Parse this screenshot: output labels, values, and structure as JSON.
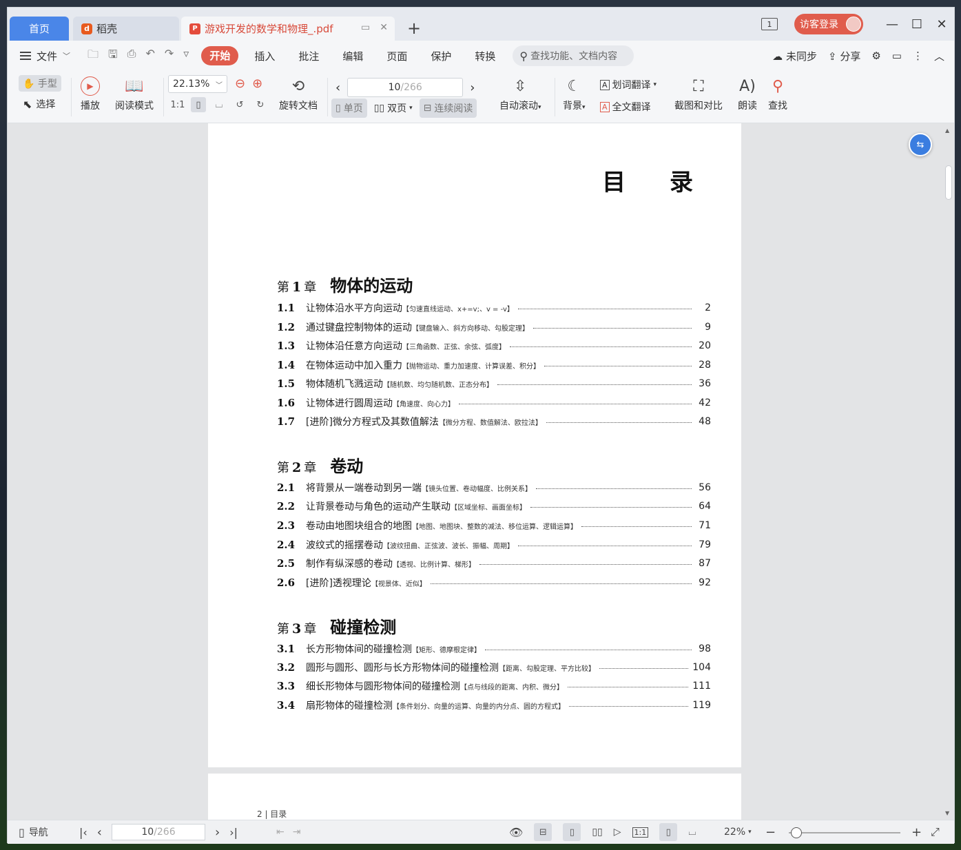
{
  "tabs": {
    "home": "首页",
    "docer": "稻壳",
    "pdf": "游戏开发的数学和物理_.pdf",
    "add": "+"
  },
  "titlebar": {
    "page_count_icon": "1",
    "login": "访客登录",
    "minimize": "—",
    "maximize": "☐",
    "close": "✕"
  },
  "menu": {
    "file": "文件",
    "tabs": [
      "开始",
      "插入",
      "批注",
      "编辑",
      "页面",
      "保护",
      "转换"
    ],
    "search_placeholder": "查找功能、文档内容",
    "sync": "未同步",
    "share": "分享"
  },
  "ribbon": {
    "hand": "手型",
    "select": "选择",
    "play": "播放",
    "read_mode": "阅读模式",
    "zoom": "22.13%",
    "rotate": "旋转文档",
    "page_current": "10",
    "page_total": "/266",
    "single": "单页",
    "double": "双页",
    "continuous": "连续阅读",
    "autoscroll": "自动滚动",
    "background": "背景",
    "word_translate": "划词翻译",
    "full_translate": "全文翻译",
    "screenshot_compare": "截图和对比",
    "read_aloud": "朗读",
    "find": "查找"
  },
  "document": {
    "toc_title": "目 录",
    "chapters": [
      {
        "pre": "第",
        "num": "1",
        "post": "章",
        "name": "物体的运动",
        "entries": [
          {
            "num": "1.1",
            "title": "让物体沿水平方向运动",
            "tags": "【匀速直线运动、x+=v;、v = -v】",
            "page": "2"
          },
          {
            "num": "1.2",
            "title": "通过键盘控制物体的运动",
            "tags": "【键盘输入、斜方向移动、勾股定理】",
            "page": "9"
          },
          {
            "num": "1.3",
            "title": "让物体沿任意方向运动",
            "tags": "【三角函数、正弦、余弦、弧度】",
            "page": "20"
          },
          {
            "num": "1.4",
            "title": "在物体运动中加入重力",
            "tags": "【抛物运动、重力加速度、计算误差、积分】",
            "page": "28"
          },
          {
            "num": "1.5",
            "title": "物体随机飞溅运动",
            "tags": "【随机数、均匀随机数、正态分布】",
            "page": "36"
          },
          {
            "num": "1.6",
            "title": "让物体进行圆周运动",
            "tags": "【角速度、向心力】",
            "page": "42"
          },
          {
            "num": "1.7",
            "title": "[进阶]微分方程式及其数值解法",
            "tags": "【微分方程、数值解法、欧拉法】",
            "page": "48"
          }
        ]
      },
      {
        "pre": "第",
        "num": "2",
        "post": "章",
        "name": "卷动",
        "entries": [
          {
            "num": "2.1",
            "title": "将背景从一端卷动到另一端",
            "tags": "【镜头位置、卷动幅度、比例关系】",
            "page": "56"
          },
          {
            "num": "2.2",
            "title": "让背景卷动与角色的运动产生联动",
            "tags": "【区域坐标、画面坐标】",
            "page": "64"
          },
          {
            "num": "2.3",
            "title": "卷动由地图块组合的地图",
            "tags": "【地图、地图块、整数的减法、移位运算、逻辑运算】",
            "page": "71"
          },
          {
            "num": "2.4",
            "title": "波纹式的摇摆卷动",
            "tags": "【波纹扭曲、正弦波、波长、振幅、周期】",
            "page": "79"
          },
          {
            "num": "2.5",
            "title": "制作有纵深感的卷动",
            "tags": "【透视、比例计算、梯形】",
            "page": "87"
          },
          {
            "num": "2.6",
            "title": "[进阶]透视理论",
            "tags": "【视景体、近似】",
            "page": "92"
          }
        ]
      },
      {
        "pre": "第",
        "num": "3",
        "post": "章",
        "name": "碰撞检测",
        "entries": [
          {
            "num": "3.1",
            "title": "长方形物体间的碰撞检测",
            "tags": "【矩形、德摩根定律】",
            "page": "98"
          },
          {
            "num": "3.2",
            "title": "圆形与圆形、圆形与长方形物体间的碰撞检测",
            "tags": "【距离、勾股定理、平方比较】",
            "page": "104"
          },
          {
            "num": "3.3",
            "title": "细长形物体与圆形物体间的碰撞检测",
            "tags": "【点与线段的距离、内积、微分】",
            "page": "111"
          },
          {
            "num": "3.4",
            "title": "扇形物体的碰撞检测",
            "tags": "【条件划分、向量的运算、向量的内分点、圆的方程式】",
            "page": "119"
          }
        ]
      }
    ],
    "next_page_footer": "2 | 目录"
  },
  "status": {
    "nav": "导航",
    "page_current": "10",
    "page_total": "/266",
    "zoom": "22%",
    "zoom_fraction": 0.02
  },
  "colors": {
    "accent": "#e05c4c",
    "home_tab": "#4a86e8",
    "float_button": "#3a7de0"
  }
}
